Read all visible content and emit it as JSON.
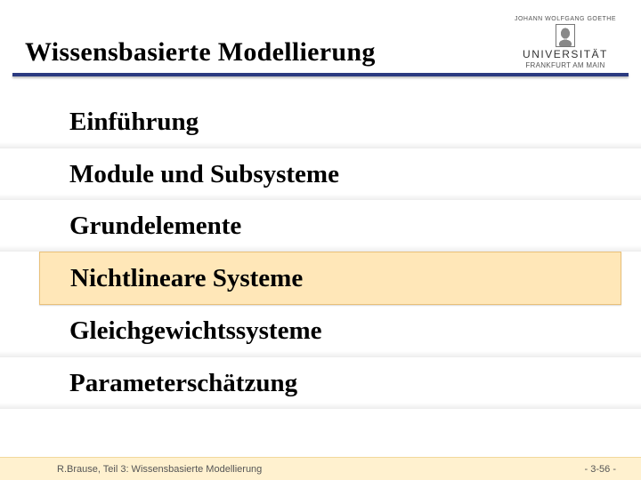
{
  "header": {
    "title": "Wissensbasierte Modellierung",
    "logo": {
      "top_line": "JOHANN WOLFGANG GOETHE",
      "university": "UNIVERSITÄT",
      "city": "FRANKFURT AM MAIN"
    }
  },
  "items": [
    {
      "label": "Einführung",
      "highlight": false
    },
    {
      "label": "Module und Subsysteme",
      "highlight": false
    },
    {
      "label": "Grundelemente",
      "highlight": false
    },
    {
      "label": "Nichtlineare Systeme",
      "highlight": true
    },
    {
      "label": "Gleichgewichtssysteme",
      "highlight": false
    },
    {
      "label": "Parameterschätzung",
      "highlight": false
    }
  ],
  "footer": {
    "left": "R.Brause, Teil 3: Wissensbasierte Modellierung",
    "right": "- 3-56 -"
  }
}
